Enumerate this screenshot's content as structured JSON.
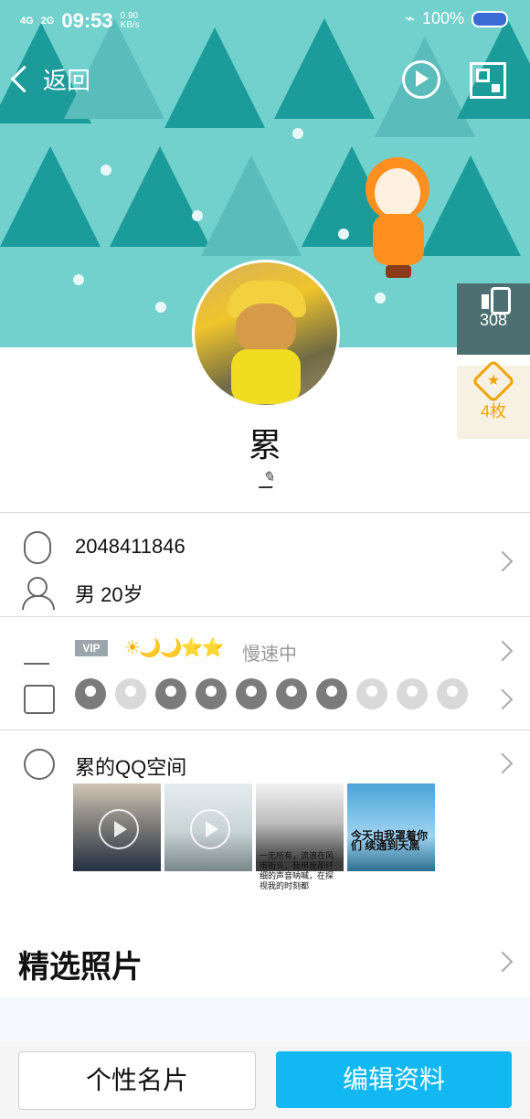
{
  "status": {
    "signal1": "4G",
    "signal2": "2G",
    "time": "09:53",
    "speed_value": "0.90",
    "speed_unit": "KB/s",
    "battery_pct": "100%"
  },
  "nav": {
    "back_label": "返回",
    "music_icon": "music-play-icon",
    "qr_icon": "qr-code-icon"
  },
  "profile": {
    "name": "累",
    "likes": "308",
    "badges": "4枚",
    "avatar_icon": "profile-avatar"
  },
  "info": {
    "qq_number": "2048411846",
    "gender_age": "男  20岁"
  },
  "levels": {
    "vip_label": "VIP",
    "level_icons": "☀🌙🌙⭐⭐",
    "speed_status": "慢速中"
  },
  "qzone": {
    "title": "累的QQ空间",
    "t3_caption": "一无所有，流浪在风雨街头，我用我那纤细的声音呐喊，在探视我的时刻都",
    "t4_caption": "今天由我罩着你们\n续通到天黑"
  },
  "featured": {
    "title": "精选照片"
  },
  "actions": {
    "left_button": "个性名片",
    "right_button": "编辑资料"
  }
}
